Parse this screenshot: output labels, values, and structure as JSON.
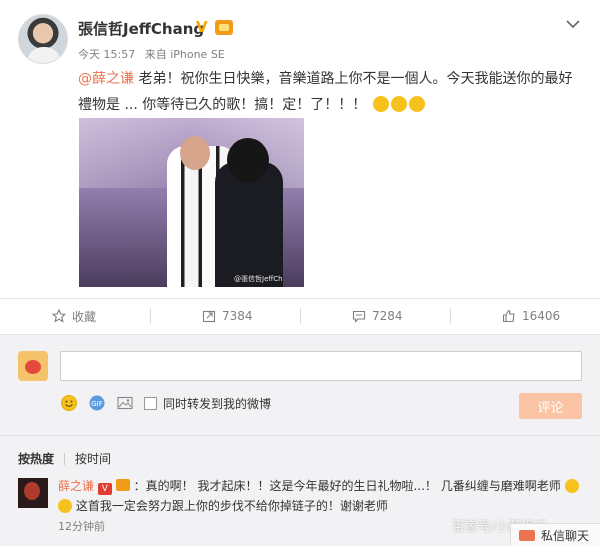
{
  "post": {
    "author": "張信哲JeffChang",
    "verified_badge": "V",
    "time": "今天 15:57",
    "source": "来自 iPhone SE",
    "mention": "@薛之谦",
    "text_line1": " 老弟！祝你生日快樂，音樂道路上你不是一個人。今天我能送你的最好",
    "text_line2": "禮物是 ... 你等待已久的歌！搞！定！了！！！",
    "photo_watermark": "@張信哲JeffCh"
  },
  "actions": {
    "collect_label": "收藏",
    "repost_count": "7384",
    "comment_count": "7284",
    "like_count": "16406"
  },
  "composer": {
    "input_value": "",
    "forward_label": "同时转发到我的微博",
    "submit_label": "评论"
  },
  "sort": {
    "hot_label": "按热度",
    "time_label": "按时间"
  },
  "comment": {
    "author": "薛之谦",
    "vip_badge": "V",
    "line1": "：真的啊！ 我才起床！！这是今年最好的生日礼物啦...！ 几番纠缠与磨难啊老师",
    "line2": " 这首我一定会努力跟上你的步伐不给你掉链子的！谢谢老师",
    "time": "12分钟前"
  },
  "dm": {
    "label": "私信聊天"
  },
  "overlay": {
    "watermark": "百家号/小菜娱乐"
  },
  "colors": {
    "mention": "#eb7350",
    "muted": "#808080",
    "submit_bg": "#fbc5a5",
    "panel_bg": "#f2f2f5"
  },
  "icons": [
    "chevron-down-icon",
    "star-icon",
    "repost-icon",
    "comment-icon",
    "like-icon",
    "smiley-icon",
    "gif-icon",
    "image-icon",
    "envelope-icon"
  ]
}
